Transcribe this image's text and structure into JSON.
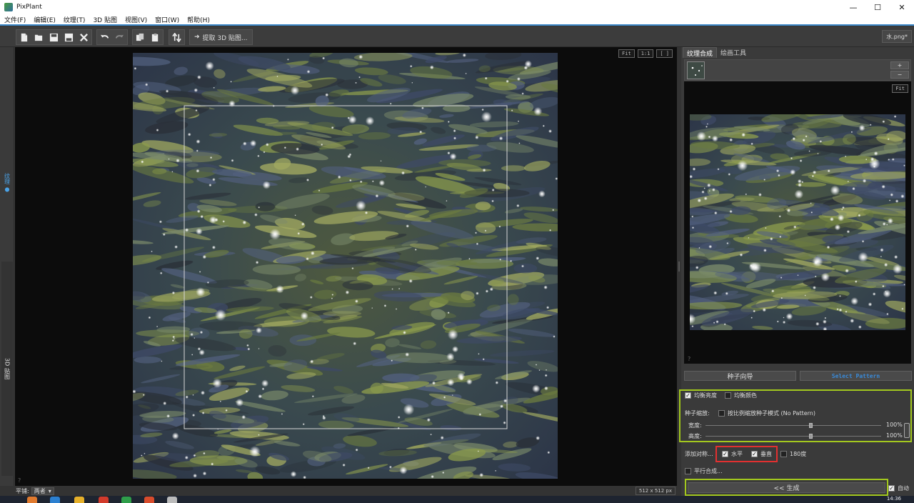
{
  "window": {
    "title": "PixPlant",
    "minimize": "—",
    "maximize": "☐",
    "close": "✕"
  },
  "menu": [
    "文件(F)",
    "编辑(E)",
    "纹理(T)",
    "3D 贴图",
    "视图(V)",
    "窗口(W)",
    "帮助(H)"
  ],
  "toolbar": {
    "extract_label": "提取 3D 贴图...",
    "file_tab": "水.png*"
  },
  "left_dock": {
    "active_tab": "纹理 ●",
    "tab_3d": "3D 贴图"
  },
  "canvas": {
    "view_buttons": [
      "Fit",
      "1:1",
      "[ ]"
    ],
    "help": "?"
  },
  "status": {
    "tile_label": "平铺:",
    "tile_value": "两者",
    "size": "512 x 512 px"
  },
  "right_panel": {
    "tabs": [
      "纹理合成",
      "绘画工具"
    ],
    "seed_buttons": [
      "+",
      "−"
    ],
    "preview_fit": "Fit",
    "preview_help": "?",
    "seed_wizard": "种子向导",
    "select_pattern": "Select Pattern",
    "balance_brightness": "均衡亮度",
    "balance_color": "均衡颜色",
    "seed_scale_label": "种子缩放:",
    "scale_by_ratio": "按比例缩放种子模式 (No Pattern)",
    "width_label": "宽度:",
    "width_value": "100%",
    "height_label": "高度:",
    "height_value": "100%",
    "add_symmetry": "添加对称...",
    "horizontal": "水平",
    "vertical": "垂直",
    "rotate180": "180度",
    "parallel": "平行合成...",
    "generate": "<< 生成",
    "auto": "自动"
  },
  "checkbox_state": {
    "balance_brightness": true,
    "balance_color": false,
    "scale_by_ratio": false,
    "horizontal": true,
    "vertical": true,
    "rotate180": false,
    "parallel": false,
    "auto": true
  },
  "sliders": {
    "width_fraction": 0.6,
    "height_fraction": 0.6
  },
  "taskbar": {
    "clock": "14:36"
  },
  "colors": {
    "highlight_green": "#a3c81e",
    "highlight_red": "#e23030",
    "accent_blue": "#3a8ad8"
  }
}
